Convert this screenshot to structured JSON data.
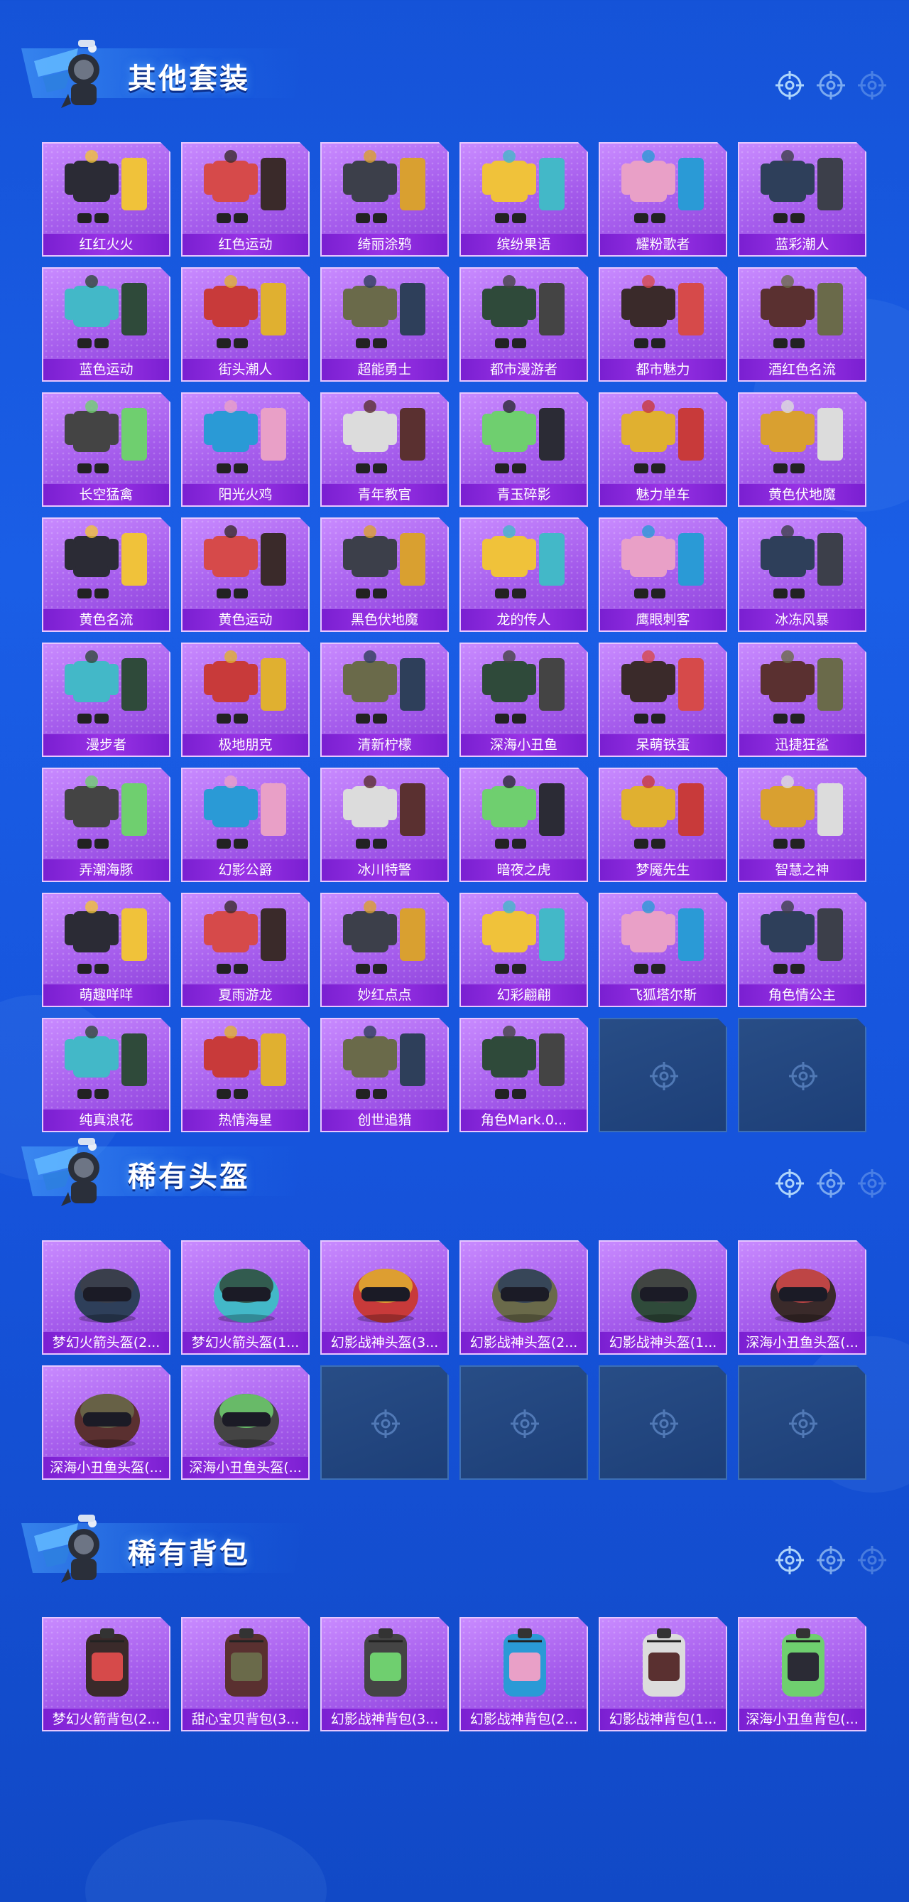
{
  "sections": [
    {
      "title": "其他套装",
      "items": [
        "红红火火",
        "红色运动",
        "绮丽涂鸦",
        "缤纷果语",
        "耀粉歌者",
        "蓝彩潮人",
        "蓝色运动",
        "街头潮人",
        "超能勇士",
        "都市漫游者",
        "都市魅力",
        "酒红色名流",
        "长空猛禽",
        "阳光火鸡",
        "青年教官",
        "青玉碎影",
        "魅力单车",
        "黄色伏地魔",
        "黄色名流",
        "黄色运动",
        "黑色伏地魔",
        "龙的传人",
        "鹰眼刺客",
        "冰冻风暴",
        "漫步者",
        "极地朋克",
        "清新柠檬",
        "深海小丑鱼",
        "呆萌铁蛋",
        "迅捷狂鲨",
        "弄潮海豚",
        "幻影公爵",
        "冰川特警",
        "暗夜之虎",
        "梦魇先生",
        "智慧之神",
        "萌趣咩咩",
        "夏雨游龙",
        "妙红点点",
        "幻彩翩翩",
        "飞狐塔尔斯",
        "角色情公主",
        "纯真浪花",
        "热情海星",
        "创世追猎",
        "角色Mark.0..."
      ],
      "empty_slots": 2
    },
    {
      "title": "稀有头盔",
      "items": [
        "梦幻火箭头盔(2...",
        "梦幻火箭头盔(1...",
        "幻影战神头盔(3...",
        "幻影战神头盔(2...",
        "幻影战神头盔(1...",
        "深海小丑鱼头盔(...",
        "深海小丑鱼头盔(...",
        "深海小丑鱼头盔(..."
      ],
      "empty_slots": 4
    },
    {
      "title": "稀有背包",
      "items": [
        "梦幻火箭背包(2...",
        "甜心宝贝背包(3...",
        "幻影战神背包(3...",
        "幻影战神背包(2...",
        "幻影战神背包(1...",
        "深海小丑鱼背包(..."
      ],
      "empty_slots": 0
    }
  ],
  "icons": {
    "mascot": "mascot-icon",
    "header_dot": "crosshair-icon",
    "empty_slot": "crosshair-icon"
  },
  "colors": {
    "card_purple": "#a55cec",
    "label_purple": "#7a1fd1",
    "empty_navy": "#1d3f78",
    "background_blue": "#1553d8"
  }
}
